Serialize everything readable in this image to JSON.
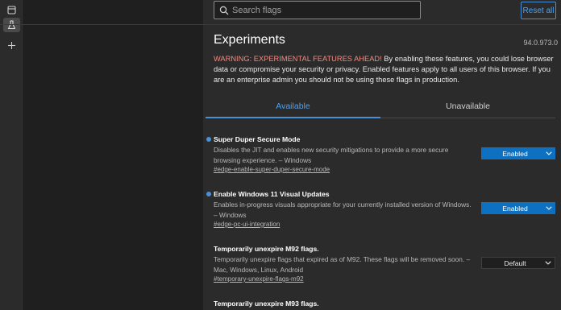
{
  "search": {
    "placeholder": "Search flags"
  },
  "toolbar": {
    "reset_label": "Reset all"
  },
  "page": {
    "title": "Experiments",
    "version": "94.0.973.0",
    "warning_prefix": "WARNING: EXPERIMENTAL FEATURES AHEAD!",
    "warning_body": " By enabling these features, you could lose browser data or compromise your security or privacy. Enabled features apply to all users of this browser. If you are an enterprise admin you should not be using these flags in production."
  },
  "tabs": [
    {
      "label": "Available",
      "selected": true
    },
    {
      "label": "Unavailable",
      "selected": false
    }
  ],
  "flags": [
    {
      "name": "Super Duper Secure Mode",
      "description": "Disables the JIT and enables new security mitigations to provide a more secure browsing experience. – Windows",
      "link": "#edge-enable-super-duper-secure-mode",
      "value": "Enabled",
      "modified": true
    },
    {
      "name": "Enable Windows 11 Visual Updates",
      "description": "Enables in-progress visuals appropriate for your currently installed version of Windows. – Windows",
      "link": "#edge-pc-ui-integration",
      "value": "Enabled",
      "modified": true
    },
    {
      "name": "Temporarily unexpire M92 flags.",
      "description": "Temporarily unexpire flags that expired as of M92. These flags will be removed soon. – Mac, Windows, Linux, Android",
      "link": "#temporary-unexpire-flags-m92",
      "value": "Default",
      "modified": false
    },
    {
      "name": "Temporarily unexpire M93 flags.",
      "modified": false
    }
  ],
  "colors": {
    "accent": "#4a90d9",
    "warning": "#f28b82",
    "enabled_select": "#0e70c0"
  },
  "icons": {
    "vertical_tabs": "tab-actions-icon",
    "active_tab": "flask-icon",
    "new_tab": "plus-icon",
    "search": "search-icon",
    "dropdown": "chevron-down-icon"
  }
}
